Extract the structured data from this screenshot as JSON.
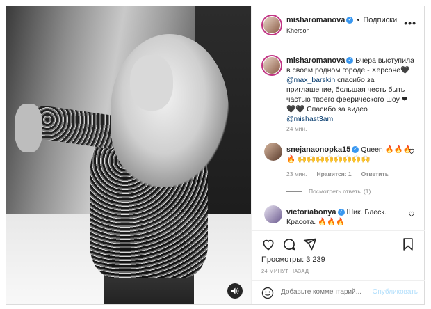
{
  "post": {
    "username": "misharomanova",
    "location": "Kherson",
    "follow_label": "Подписки",
    "more_label": "•••"
  },
  "caption": {
    "username": "misharomanova",
    "text_before_mention": "Вчера выступила в своём родном городе - Херсоне🖤 ",
    "mention1": "@max_barskih",
    "text_middle": " спасибо за приглашение, большая честь быть частью твоего феерического шоу ❤ 🖤🖤 Спасибо за видео ",
    "mention2": "@mishast3am",
    "time": "24 мин."
  },
  "comments": [
    {
      "username": "snejanaonopka15",
      "text": "Queen 🔥🔥🔥🔥 🙌🙌🙌🙌🙌🙌🙌🙌",
      "time": "23 мин.",
      "likes": "Нравится: 1",
      "reply": "Ответить",
      "view_replies": "Посмотреть ответы (1)"
    },
    {
      "username": "victoriabonya",
      "text": "Шик. Блеск. Красота. 🔥🔥🔥"
    }
  ],
  "stats": {
    "views": "Просмотры: 3 239",
    "posted_ago": "24 МИНУТ НАЗАД"
  },
  "add_comment": {
    "placeholder": "Добавьте комментарий...",
    "publish_label": "Опубликовать"
  },
  "icons": {
    "like": "heart-icon",
    "comment": "comment-icon",
    "share": "share-icon",
    "save": "bookmark-icon",
    "emoji": "emoji-icon",
    "sound": "sound-icon",
    "verified": "verified-badge-icon"
  },
  "colors": {
    "accent": "#3897f0",
    "mention": "#00376b",
    "muted": "#8e8e8e",
    "publish_disabled": "#b2dffc"
  }
}
